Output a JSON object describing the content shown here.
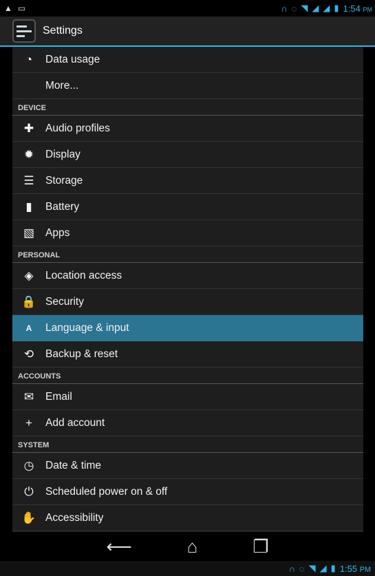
{
  "status_bar": {
    "left_icons": [
      "warning-icon",
      "image-icon"
    ],
    "right_icons": [
      "headset-icon",
      "sync-icon",
      "wifi-icon",
      "signal-icon",
      "signal-icon",
      "battery-icon"
    ],
    "time": "1:54",
    "ampm": "PM"
  },
  "action_bar": {
    "title": "Settings"
  },
  "list": [
    {
      "type": "item",
      "icon": "data-usage-icon",
      "glyph": "◔",
      "label": "Data usage"
    },
    {
      "type": "item",
      "icon": "",
      "glyph": "",
      "label": "More..."
    },
    {
      "type": "header",
      "label": "DEVICE"
    },
    {
      "type": "item",
      "icon": "audio-profiles-icon",
      "glyph": "✚",
      "label": "Audio profiles"
    },
    {
      "type": "item",
      "icon": "display-icon",
      "glyph": "✹",
      "label": "Display"
    },
    {
      "type": "item",
      "icon": "storage-icon",
      "glyph": "☰",
      "label": "Storage"
    },
    {
      "type": "item",
      "icon": "battery-icon",
      "glyph": "▮",
      "label": "Battery"
    },
    {
      "type": "item",
      "icon": "apps-icon",
      "glyph": "▧",
      "label": "Apps"
    },
    {
      "type": "header",
      "label": "PERSONAL"
    },
    {
      "type": "item",
      "icon": "location-icon",
      "glyph": "◈",
      "label": "Location access"
    },
    {
      "type": "item",
      "icon": "lock-icon",
      "glyph": "🔒",
      "label": "Security"
    },
    {
      "type": "item",
      "icon": "language-icon",
      "glyph": "A",
      "label": "Language & input",
      "selected": true
    },
    {
      "type": "item",
      "icon": "backup-icon",
      "glyph": "⟲",
      "label": "Backup & reset"
    },
    {
      "type": "header",
      "label": "ACCOUNTS"
    },
    {
      "type": "item",
      "icon": "email-icon",
      "glyph": "✉",
      "label": "Email"
    },
    {
      "type": "item",
      "icon": "add-icon",
      "glyph": "+",
      "label": "Add account"
    },
    {
      "type": "header",
      "label": "SYSTEM"
    },
    {
      "type": "item",
      "icon": "clock-icon",
      "glyph": "◷",
      "label": "Date & time"
    },
    {
      "type": "item",
      "icon": "power-schedule-icon",
      "glyph": "⏻",
      "label": "Scheduled power on & off"
    },
    {
      "type": "item",
      "icon": "hand-icon",
      "glyph": "✋",
      "label": "Accessibility"
    }
  ],
  "nav_bar": {
    "back_icon": "back-icon",
    "home_icon": "home-icon",
    "recents_icon": "recents-icon"
  },
  "bottom_bar": {
    "time": "1:55",
    "ampm": "PM"
  }
}
